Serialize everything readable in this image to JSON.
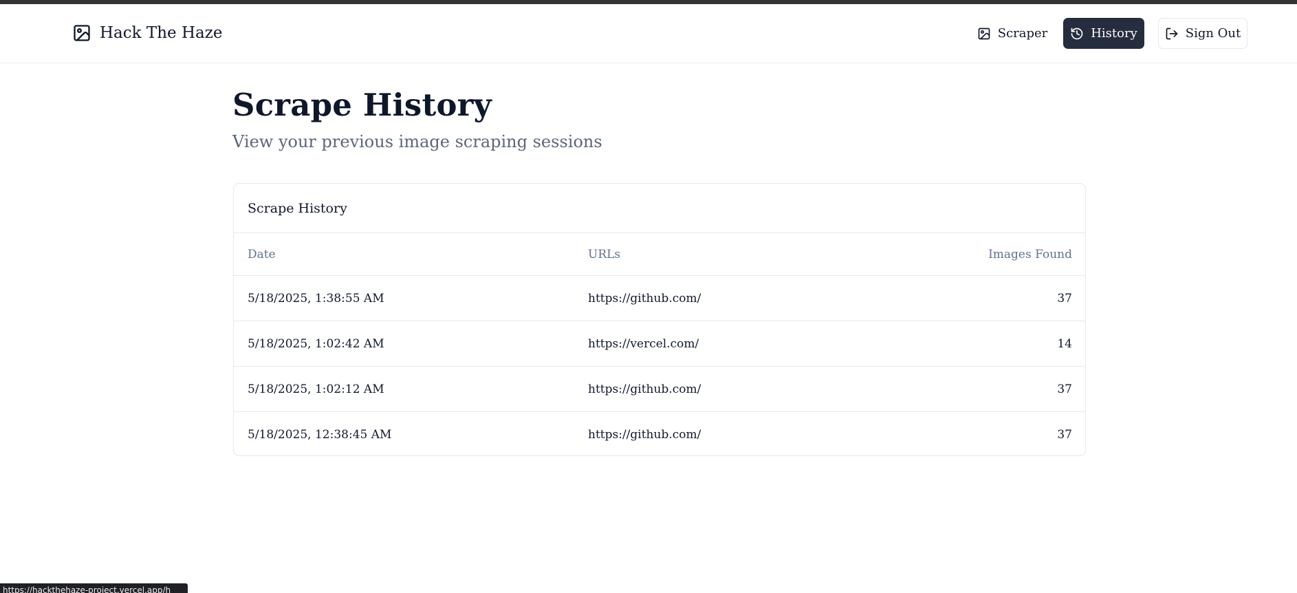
{
  "app": {
    "name": "Hack The Haze",
    "logo_icon": "image-icon"
  },
  "nav": {
    "scraper": {
      "label": "Scraper",
      "icon": "image-icon"
    },
    "history": {
      "label": "History",
      "icon": "history-icon",
      "active": true
    },
    "signout": {
      "label": "Sign Out",
      "icon": "log-out-icon"
    }
  },
  "page": {
    "title": "Scrape History",
    "subtitle": "View your previous image scraping sessions"
  },
  "table": {
    "title": "Scrape History",
    "columns": [
      "Date",
      "URLs",
      "Images Found"
    ],
    "rows": [
      {
        "date": "5/18/2025, 1:38:55 AM",
        "url": "https://github.com/",
        "images": "37"
      },
      {
        "date": "5/18/2025, 1:02:42 AM",
        "url": "https://vercel.com/",
        "images": "14"
      },
      {
        "date": "5/18/2025, 1:02:12 AM",
        "url": "https://github.com/",
        "images": "37"
      },
      {
        "date": "5/18/2025, 12:38:45 AM",
        "url": "https://github.com/",
        "images": "37"
      }
    ]
  },
  "status_bar": {
    "url": "https://hackthehaze-project.vercel.app/h"
  },
  "colors": {
    "active_button": "#262d3e",
    "muted_text": "#5b6679",
    "header_text": "#5f7290"
  }
}
